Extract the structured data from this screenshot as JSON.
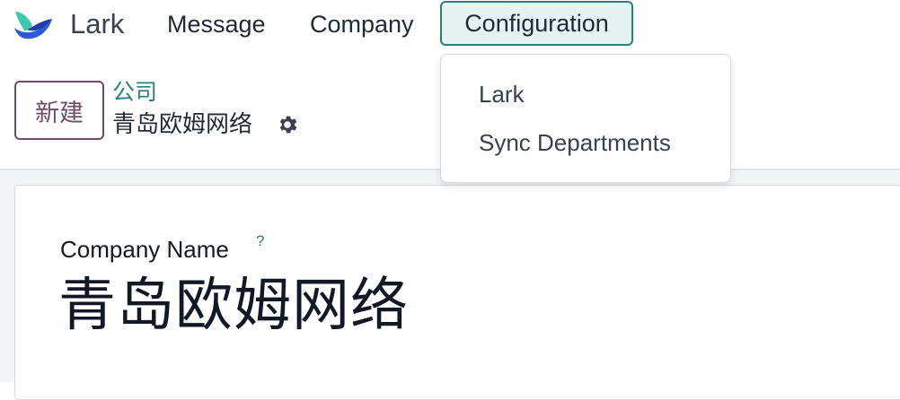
{
  "navbar": {
    "app_name": "Lark",
    "items": [
      "Message",
      "Company",
      "Configuration"
    ]
  },
  "dropdown": {
    "items": [
      "Lark",
      "Sync Departments"
    ]
  },
  "control_panel": {
    "new_button_label": "新建",
    "breadcrumb": "公司",
    "record_title": "青岛欧姆网络"
  },
  "form": {
    "field_label": "Company Name",
    "help_mark": "?",
    "company_name": "青岛欧姆网络"
  },
  "colors": {
    "accent_teal": "#2f7d81",
    "primary_purple": "#714b67",
    "logo_teal": "#3ec7b0",
    "logo_blue": "#2b5bd7"
  },
  "icons": [
    "lark-logo-icon",
    "gear-icon"
  ]
}
